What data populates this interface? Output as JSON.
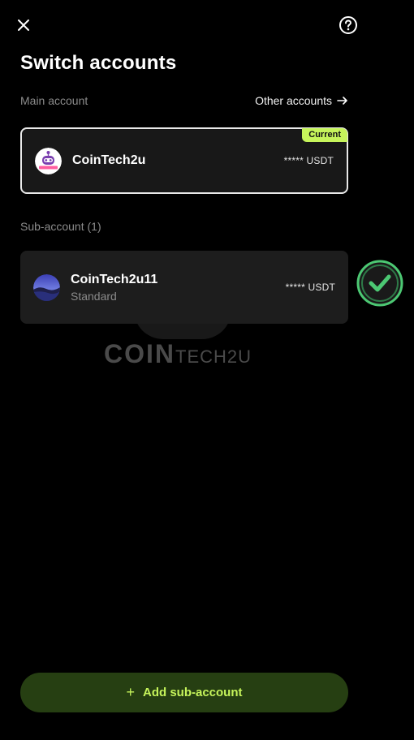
{
  "header": {
    "close_icon": "close-icon",
    "help_icon": "question-circle-icon",
    "title": "Switch accounts"
  },
  "main_section": {
    "label": "Main account",
    "other_link": "Other accounts",
    "other_icon": "arrow-right-icon",
    "card": {
      "name": "CoinTech2u",
      "balance": "***** USDT",
      "badge": "Current",
      "avatar_icon": "robot-logo-avatar"
    }
  },
  "sub_section": {
    "label": "Sub-account (1)",
    "card": {
      "name": "CoinTech2u11",
      "type": "Standard",
      "balance": "***** USDT",
      "avatar_icon": "landscape-avatar"
    }
  },
  "watermark": {
    "coin": "COIN",
    "tech": "TECH2U"
  },
  "footer": {
    "add_label": "Add sub-account",
    "add_icon": "plus-icon"
  },
  "colors": {
    "accent": "#c6f45b",
    "button_bg": "#263f12",
    "check_green": "#4cc873"
  }
}
